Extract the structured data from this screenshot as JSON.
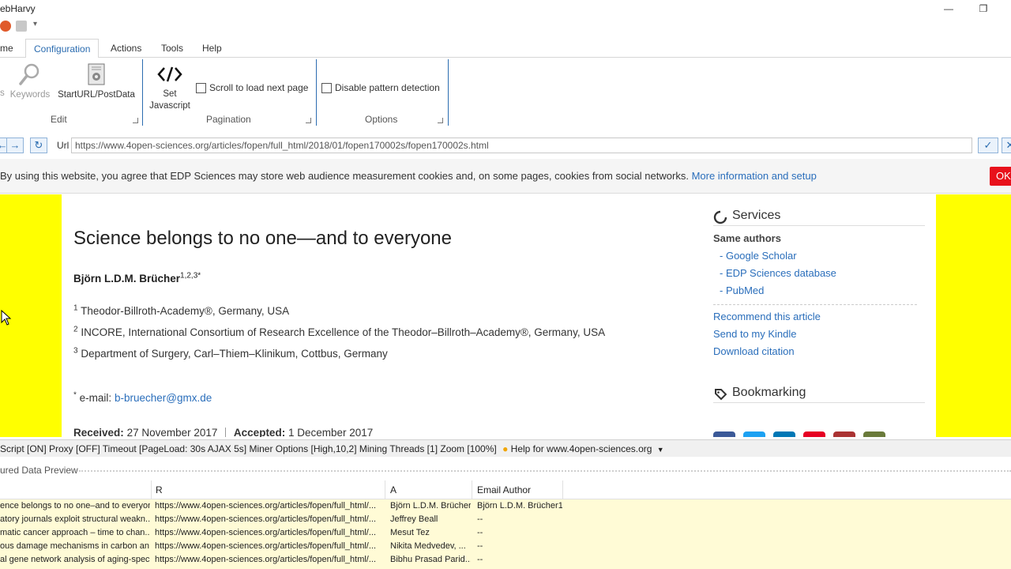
{
  "window": {
    "title": "ebHarvy"
  },
  "ribbon": {
    "tabs": [
      {
        "label": "me",
        "active": false
      },
      {
        "label": "Configuration",
        "active": true
      },
      {
        "label": "Actions",
        "active": false
      },
      {
        "label": "Tools",
        "active": false
      },
      {
        "label": "Help",
        "active": false
      }
    ],
    "edit_group": {
      "keywords_label": "Keywords",
      "start_url_label": "StartURL/PostData",
      "group_label": "Edit",
      "left_partial": "s"
    },
    "javascript": {
      "line1": "Set",
      "line2": "Javascript"
    },
    "pagination": {
      "scroll_label": "Scroll to load next page",
      "group_label": "Pagination"
    },
    "options": {
      "disable_pattern_label": "Disable pattern detection",
      "group_label": "Options"
    }
  },
  "address": {
    "label": "Url",
    "url": "https://www.4open-sciences.org/articles/fopen/full_html/2018/01/fopen170002s/fopen170002s.html"
  },
  "cookie_banner": {
    "text": "By using this website, you agree that EDP Sciences may store web audience measurement cookies and, on some pages, cookies from social networks.",
    "link": "More information and setup",
    "ok": "OK"
  },
  "article": {
    "title": "Science belongs to no one—and to everyone",
    "author": "Björn L.D.M. Brücher",
    "author_sup": "1,2,3*",
    "affiliations": [
      {
        "num": "1",
        "text": "Theodor-Billroth-Academy®, Germany, USA"
      },
      {
        "num": "2",
        "text": "INCORE, International Consortium of Research Excellence of the Theodor–Billroth–Academy®, Germany, USA"
      },
      {
        "num": "3",
        "text": "Department of Surgery, Carl–Thiem–Klinikum, Cottbus, Germany"
      }
    ],
    "email_star": "*",
    "email_label": "e-mail:",
    "email": "b-bruecher@gmx.de",
    "received_label": "Received:",
    "received": "27 November 2017",
    "accepted_label": "Accepted:",
    "accepted": "1 December 2017"
  },
  "sidebar": {
    "services_title": "Services",
    "same_authors": "Same authors",
    "author_links": [
      "Google Scholar",
      "EDP Sciences database",
      "PubMed"
    ],
    "links": [
      "Recommend this article",
      "Send to my Kindle",
      "Download citation"
    ],
    "bookmarking_title": "Bookmarking"
  },
  "statusbar": {
    "text": "Script [ON] Proxy [OFF] Timeout [PageLoad: 30s AJAX 5s] Miner Options [High,10,2] Mining Threads [1] Zoom [100%]",
    "help": "Help for www.4open-sciences.org"
  },
  "captured": {
    "title": "ured Data Preview",
    "columns": [
      "R",
      "A",
      "Email Author"
    ],
    "rows": [
      [
        "ence belongs to no one–and to everyone",
        "https://www.4open-sciences.org/articles/fopen/full_html/...",
        "Björn L.D.M. Brücher",
        "Björn L.D.M. Brücher1"
      ],
      [
        "atory journals exploit structural weakn...",
        "https://www.4open-sciences.org/articles/fopen/full_html/...",
        "Jeffrey Beall",
        "--"
      ],
      [
        "matic cancer approach – time to chan...",
        "https://www.4open-sciences.org/articles/fopen/full_html/...",
        "Mesut Tez",
        "--"
      ],
      [
        "ous damage mechanisms in carbon an...",
        "https://www.4open-sciences.org/articles/fopen/full_html/...",
        "Nikita Medvedev, ...",
        "--"
      ],
      [
        "al gene network analysis of aging-spec...",
        "https://www.4open-sciences.org/articles/fopen/full_html/...",
        "Bibhu Prasad Parid...",
        "--"
      ]
    ]
  },
  "colors": {
    "accent": "#2b6cb0",
    "page_bg": "#ffff00",
    "link": "#2a6ebb",
    "ok_button": "#e8111b",
    "grid_row": "#fffbd6"
  }
}
